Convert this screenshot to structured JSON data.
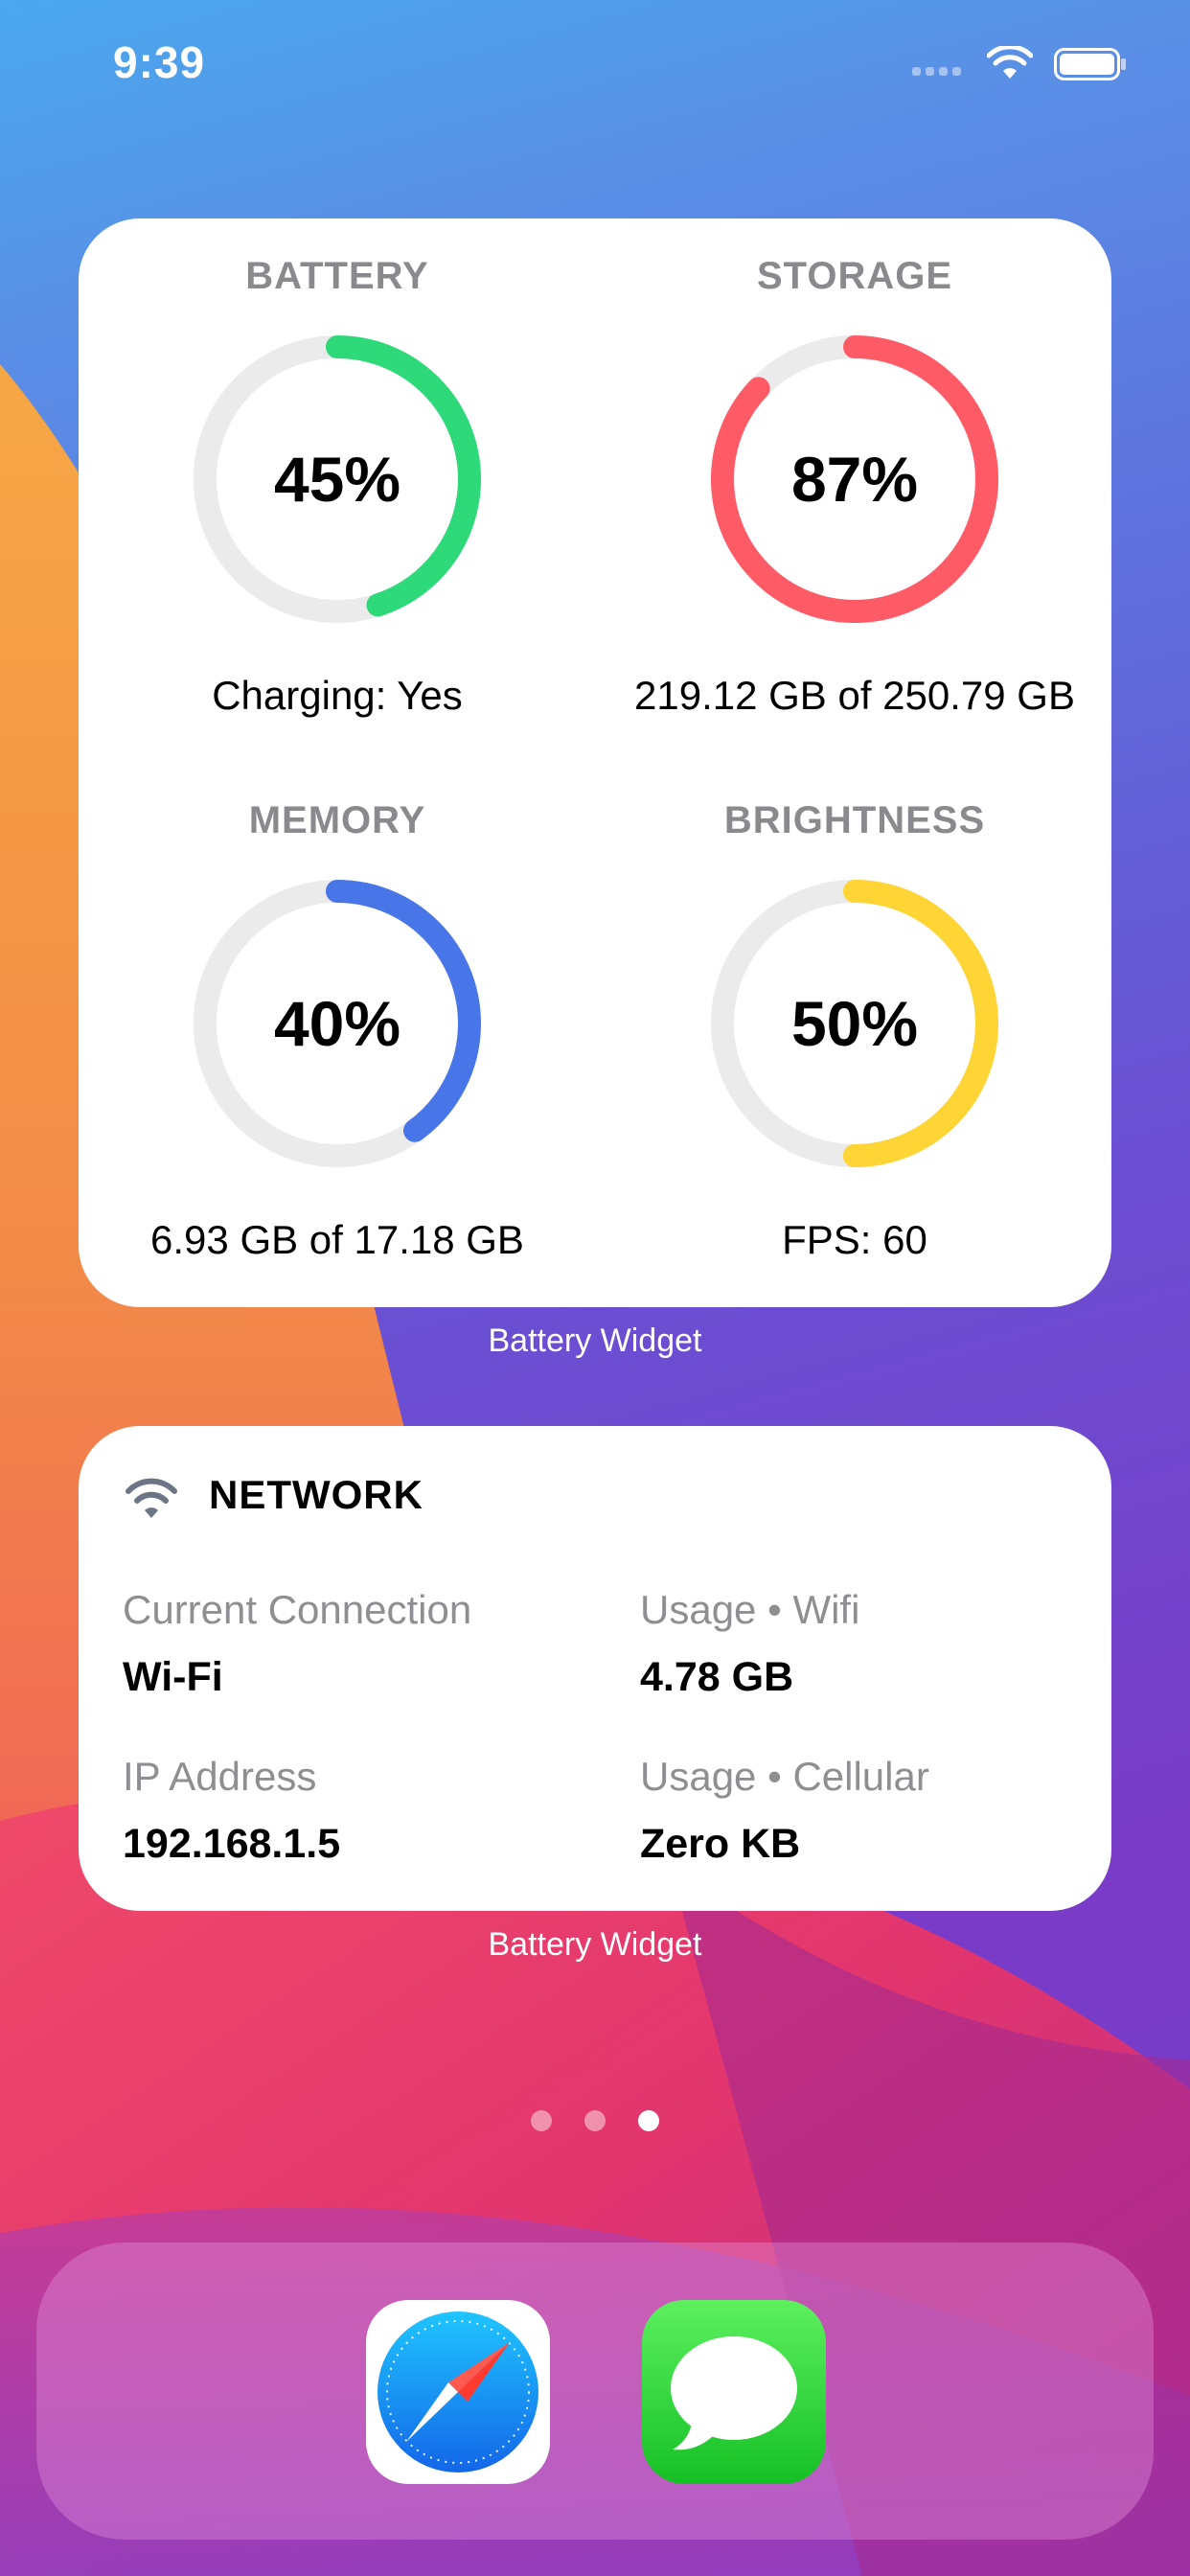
{
  "status_bar": {
    "time": "9:39"
  },
  "stats_widget": {
    "gauges": [
      {
        "title": "BATTERY",
        "value": "45%",
        "percent": 45,
        "detail": "Charging: Yes",
        "color": "#2ed97a"
      },
      {
        "title": "STORAGE",
        "value": "87%",
        "percent": 87,
        "detail": "219.12 GB of 250.79 GB",
        "color": "#ff5b66"
      },
      {
        "title": "MEMORY",
        "value": "40%",
        "percent": 40,
        "detail": "6.93 GB of 17.18 GB",
        "color": "#4876e8"
      },
      {
        "title": "BRIGHTNESS",
        "value": "50%",
        "percent": 50,
        "detail": "FPS: 60",
        "color": "#ffd535"
      }
    ],
    "track_color": "#ebebeb",
    "caption": "Battery Widget"
  },
  "network_widget": {
    "title": "NETWORK",
    "icon": "wifi-icon",
    "items": [
      {
        "label": "Current Connection",
        "value": "Wi-Fi"
      },
      {
        "label": "Usage • Wifi",
        "value": "4.78 GB"
      },
      {
        "label": "IP Address",
        "value": "192.168.1.5"
      },
      {
        "label": "Usage • Cellular",
        "value": "Zero KB"
      }
    ],
    "caption": "Battery Widget"
  },
  "page_indicator": {
    "count": 3,
    "active": 3
  },
  "dock": {
    "apps": [
      {
        "icon": "safari-icon"
      },
      {
        "icon": "messages-icon"
      }
    ]
  }
}
